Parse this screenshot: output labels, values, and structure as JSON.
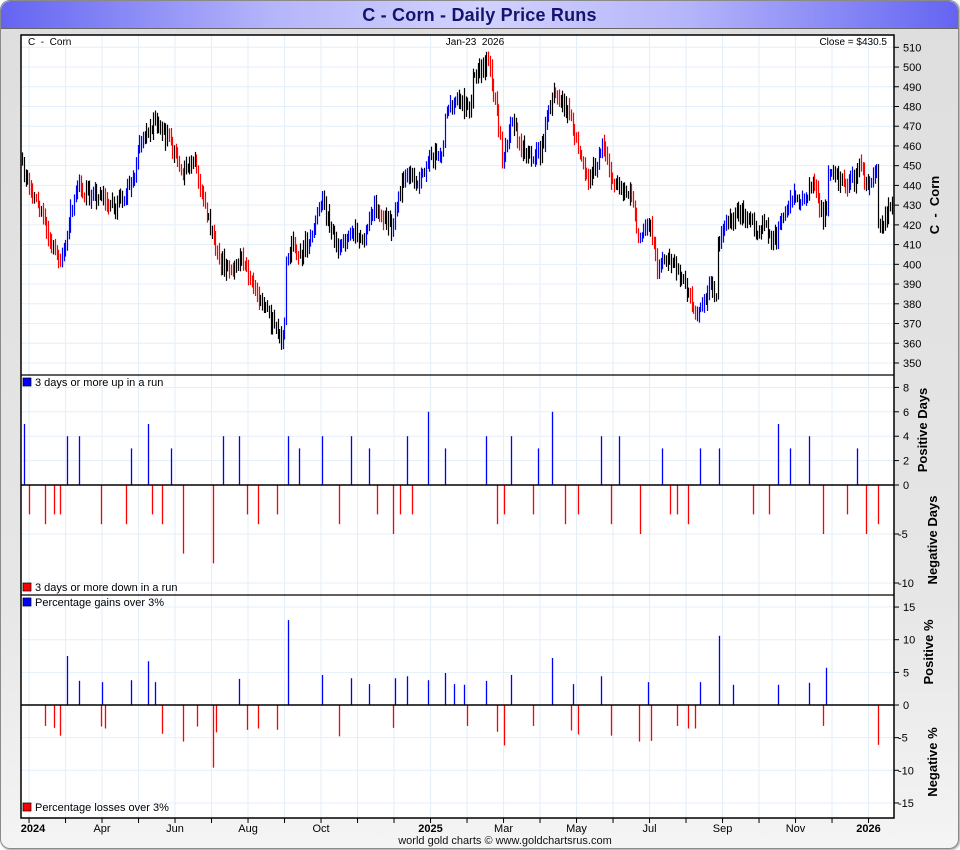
{
  "title": "C  -  Corn - Daily Price Runs",
  "footer": "world gold charts © www.goldchartsrus.com",
  "chart_data": {
    "type": "bar",
    "title": "C  -  Corn - Daily Price Runs",
    "symbol_label": "C  -  Corn",
    "date_label": "Jan-23  2026",
    "close_label": "Close = $430.5",
    "close": 430.5,
    "x_unit": "months since Jan 1 2024",
    "x_range": [
      0.78,
      24.7
    ],
    "x_ticks": [
      {
        "label": "2024",
        "m": 1.1,
        "bold": true
      },
      {
        "label": "Apr",
        "m": 3,
        "bold": false
      },
      {
        "label": "Jun",
        "m": 5,
        "bold": false
      },
      {
        "label": "Aug",
        "m": 7,
        "bold": false
      },
      {
        "label": "Oct",
        "m": 9,
        "bold": false
      },
      {
        "label": "2025",
        "m": 12,
        "bold": true
      },
      {
        "label": "Mar",
        "m": 14,
        "bold": false
      },
      {
        "label": "May",
        "m": 16,
        "bold": false
      },
      {
        "label": "Jul",
        "m": 18,
        "bold": false
      },
      {
        "label": "Sep",
        "m": 20,
        "bold": false
      },
      {
        "label": "Nov",
        "m": 22,
        "bold": false
      },
      {
        "label": "2026",
        "m": 24,
        "bold": true
      }
    ],
    "price_panel": {
      "axis_title": "C  -  Corn",
      "ylim": [
        344,
        516
      ],
      "ticks": [
        350,
        360,
        370,
        380,
        390,
        400,
        410,
        420,
        430,
        440,
        450,
        460,
        470,
        480,
        490,
        500,
        510
      ],
      "up_run_color": "#0000ff",
      "down_run_color": "#ff0000",
      "bar_color": "#000000",
      "approx_close_path": [
        [
          0.81,
          449
        ],
        [
          1.85,
          398
        ],
        [
          2.26,
          439
        ],
        [
          3.36,
          430
        ],
        [
          3.77,
          440
        ],
        [
          4.12,
          465
        ],
        [
          4.45,
          472
        ],
        [
          4.92,
          460
        ],
        [
          5.19,
          442
        ],
        [
          5.47,
          455
        ],
        [
          5.74,
          437
        ],
        [
          6.1,
          408
        ],
        [
          6.45,
          395
        ],
        [
          6.84,
          405
        ],
        [
          7.19,
          384
        ],
        [
          7.55,
          374
        ],
        [
          7.88,
          364
        ],
        [
          7.99,
          369
        ],
        [
          8.04,
          400
        ],
        [
          8.21,
          411
        ],
        [
          8.37,
          403
        ],
        [
          8.64,
          411
        ],
        [
          9.05,
          431
        ],
        [
          9.52,
          405
        ],
        [
          9.85,
          418
        ],
        [
          10.15,
          413
        ],
        [
          10.48,
          430
        ],
        [
          10.97,
          418
        ],
        [
          11.11,
          434
        ],
        [
          11.38,
          449
        ],
        [
          11.66,
          440
        ],
        [
          11.93,
          454
        ],
        [
          12.32,
          455
        ],
        [
          12.4,
          474
        ],
        [
          12.75,
          487
        ],
        [
          13.03,
          477
        ],
        [
          13.16,
          494
        ],
        [
          13.55,
          502
        ],
        [
          13.71,
          489
        ],
        [
          13.99,
          452
        ],
        [
          14.23,
          474
        ],
        [
          14.45,
          459
        ],
        [
          14.81,
          452
        ],
        [
          15.05,
          460
        ],
        [
          15.33,
          487
        ],
        [
          15.82,
          476
        ],
        [
          16.1,
          454
        ],
        [
          16.37,
          442
        ],
        [
          16.7,
          460
        ],
        [
          17.0,
          439
        ],
        [
          17.47,
          437
        ],
        [
          17.66,
          415
        ],
        [
          18.01,
          420
        ],
        [
          18.21,
          400
        ],
        [
          18.48,
          405
        ],
        [
          18.92,
          391
        ],
        [
          19.3,
          374
        ],
        [
          19.47,
          381
        ],
        [
          19.71,
          388
        ],
        [
          19.82,
          383
        ],
        [
          19.85,
          408
        ],
        [
          20.01,
          420
        ],
        [
          20.4,
          427
        ],
        [
          20.67,
          424
        ],
        [
          20.95,
          415
        ],
        [
          21.11,
          421
        ],
        [
          21.36,
          411
        ],
        [
          21.66,
          423
        ],
        [
          21.9,
          434
        ],
        [
          22.21,
          430
        ],
        [
          22.45,
          440
        ],
        [
          22.75,
          425
        ],
        [
          22.86,
          431
        ],
        [
          22.89,
          447
        ],
        [
          23.14,
          445
        ],
        [
          23.44,
          439
        ],
        [
          23.77,
          449
        ],
        [
          23.99,
          439
        ],
        [
          24.23,
          447
        ],
        [
          24.26,
          421
        ],
        [
          24.4,
          421
        ],
        [
          24.64,
          430.5
        ]
      ]
    },
    "runs_panel": {
      "legend_up": "3 days or more up in a run",
      "legend_down": "3 days or more down in a run",
      "axis_title_pos": "Positive Days",
      "axis_title_neg": "Negative Days",
      "ticks": [
        8,
        6,
        4,
        2,
        0,
        -5,
        -10
      ],
      "up_color": "#0000ff",
      "down_color": "#ff0000",
      "up": [
        [
          0.87,
          5
        ],
        [
          2.05,
          4
        ],
        [
          2.38,
          4
        ],
        [
          3.8,
          3
        ],
        [
          4.25,
          5
        ],
        [
          4.9,
          3
        ],
        [
          6.32,
          4
        ],
        [
          6.76,
          4
        ],
        [
          8.09,
          4
        ],
        [
          8.41,
          3
        ],
        [
          9.04,
          4
        ],
        [
          9.83,
          4
        ],
        [
          10.32,
          3
        ],
        [
          11.36,
          4
        ],
        [
          11.94,
          6
        ],
        [
          12.41,
          3
        ],
        [
          13.53,
          4
        ],
        [
          14.21,
          4
        ],
        [
          14.95,
          3
        ],
        [
          15.34,
          6
        ],
        [
          16.68,
          4
        ],
        [
          17.15,
          4
        ],
        [
          18.35,
          3
        ],
        [
          19.39,
          3
        ],
        [
          19.91,
          3
        ],
        [
          21.53,
          5
        ],
        [
          21.86,
          3
        ],
        [
          22.38,
          4
        ],
        [
          23.69,
          3
        ]
      ],
      "down": [
        [
          1.01,
          -3
        ],
        [
          1.43,
          -4
        ],
        [
          1.68,
          -3
        ],
        [
          1.86,
          -3
        ],
        [
          2.96,
          -4
        ],
        [
          3.67,
          -4
        ],
        [
          4.38,
          -3
        ],
        [
          4.65,
          -4
        ],
        [
          5.23,
          -7
        ],
        [
          6.05,
          -8
        ],
        [
          6.98,
          -3
        ],
        [
          7.28,
          -4
        ],
        [
          7.8,
          -3
        ],
        [
          9.5,
          -4
        ],
        [
          10.54,
          -3
        ],
        [
          10.98,
          -5
        ],
        [
          11.17,
          -3
        ],
        [
          11.5,
          -3
        ],
        [
          13.83,
          -4
        ],
        [
          14.02,
          -3
        ],
        [
          14.82,
          -3
        ],
        [
          15.68,
          -4
        ],
        [
          16.05,
          -3
        ],
        [
          16.95,
          -4
        ],
        [
          17.73,
          -5
        ],
        [
          18.57,
          -3
        ],
        [
          18.76,
          -3
        ],
        [
          19.06,
          -4
        ],
        [
          20.84,
          -3
        ],
        [
          21.28,
          -3
        ],
        [
          22.76,
          -5
        ],
        [
          23.42,
          -3
        ],
        [
          23.94,
          -5
        ],
        [
          24.27,
          -4
        ]
      ]
    },
    "pct_panel": {
      "legend_up": "Percentage gains over 3%",
      "legend_down": "Percentage losses over 3%",
      "axis_title_pos": "Positive %",
      "axis_title_neg": "Negative %",
      "ticks": [
        15,
        10,
        5,
        0,
        -5,
        -10,
        -15
      ],
      "up_color": "#0000ff",
      "down_color": "#ff0000",
      "up": [
        [
          2.05,
          7.5
        ],
        [
          2.38,
          3.7
        ],
        [
          3.01,
          3.5
        ],
        [
          3.8,
          3.8
        ],
        [
          4.25,
          6.7
        ],
        [
          4.46,
          3.5
        ],
        [
          6.76,
          4.0
        ],
        [
          8.09,
          13.0
        ],
        [
          9.04,
          4.6
        ],
        [
          9.83,
          4.1
        ],
        [
          10.32,
          3.2
        ],
        [
          11.04,
          4.1
        ],
        [
          11.36,
          4.4
        ],
        [
          11.94,
          3.8
        ],
        [
          12.41,
          4.9
        ],
        [
          12.65,
          3.2
        ],
        [
          12.93,
          3.1
        ],
        [
          13.53,
          3.7
        ],
        [
          14.21,
          4.6
        ],
        [
          15.34,
          7.2
        ],
        [
          15.91,
          3.2
        ],
        [
          16.68,
          4.4
        ],
        [
          17.97,
          3.5
        ],
        [
          19.39,
          3.5
        ],
        [
          19.91,
          10.6
        ],
        [
          20.3,
          3.1
        ],
        [
          21.53,
          3.1
        ],
        [
          22.38,
          3.4
        ],
        [
          22.84,
          5.7
        ]
      ],
      "down": [
        [
          1.43,
          -3.2
        ],
        [
          1.68,
          -3.5
        ],
        [
          1.86,
          -4.7
        ],
        [
          2.96,
          -3.3
        ],
        [
          3.09,
          -3.6
        ],
        [
          4.65,
          -4.4
        ],
        [
          5.23,
          -5.6
        ],
        [
          5.61,
          -3.3
        ],
        [
          6.05,
          -9.6
        ],
        [
          6.13,
          -4.2
        ],
        [
          6.98,
          -3.8
        ],
        [
          7.28,
          -3.6
        ],
        [
          7.8,
          -3.8
        ],
        [
          9.5,
          -4.8
        ],
        [
          10.98,
          -3.5
        ],
        [
          13.01,
          -3.2
        ],
        [
          13.83,
          -4.1
        ],
        [
          14.02,
          -6.2
        ],
        [
          14.82,
          -3.2
        ],
        [
          15.86,
          -3.9
        ],
        [
          16.05,
          -4.5
        ],
        [
          16.95,
          -4.7
        ],
        [
          17.72,
          -5.6
        ],
        [
          18.05,
          -5.5
        ],
        [
          18.76,
          -3.2
        ],
        [
          19.06,
          -3.6
        ],
        [
          19.25,
          -3.6
        ],
        [
          22.76,
          -3.2
        ],
        [
          24.27,
          -6.1
        ]
      ]
    }
  }
}
